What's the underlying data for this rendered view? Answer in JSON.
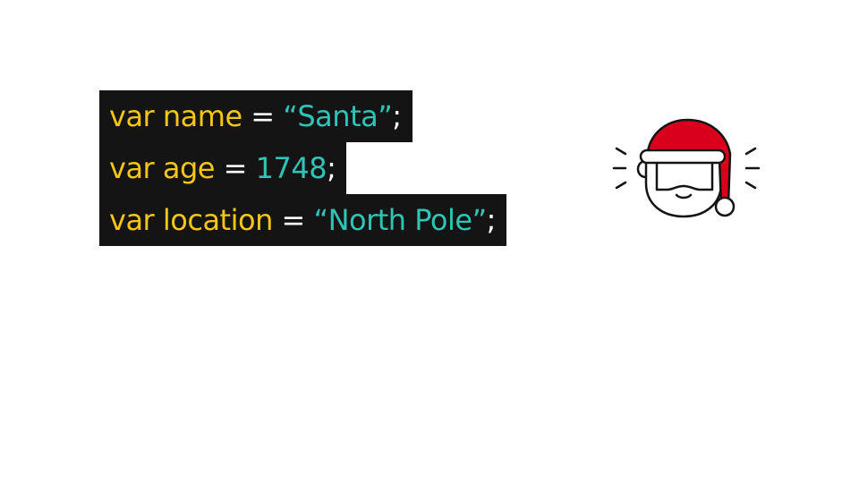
{
  "code": {
    "lines": [
      {
        "keyword": "var name",
        "op": " = ",
        "value": "“Santa”",
        "end": ";"
      },
      {
        "keyword": "var age",
        "op": " = ",
        "value": "1748",
        "end": ";"
      },
      {
        "keyword": "var location",
        "op": " = ",
        "value": "“North Pole”",
        "end": ";"
      }
    ]
  },
  "colors": {
    "background": "#ffffff",
    "code_background": "#141414",
    "keyword": "#f5c518",
    "operator": "#ffffff",
    "value": "#2ec4b6",
    "santa_hat": "#d9001b"
  },
  "illustration": {
    "icon": "santa-icon"
  }
}
